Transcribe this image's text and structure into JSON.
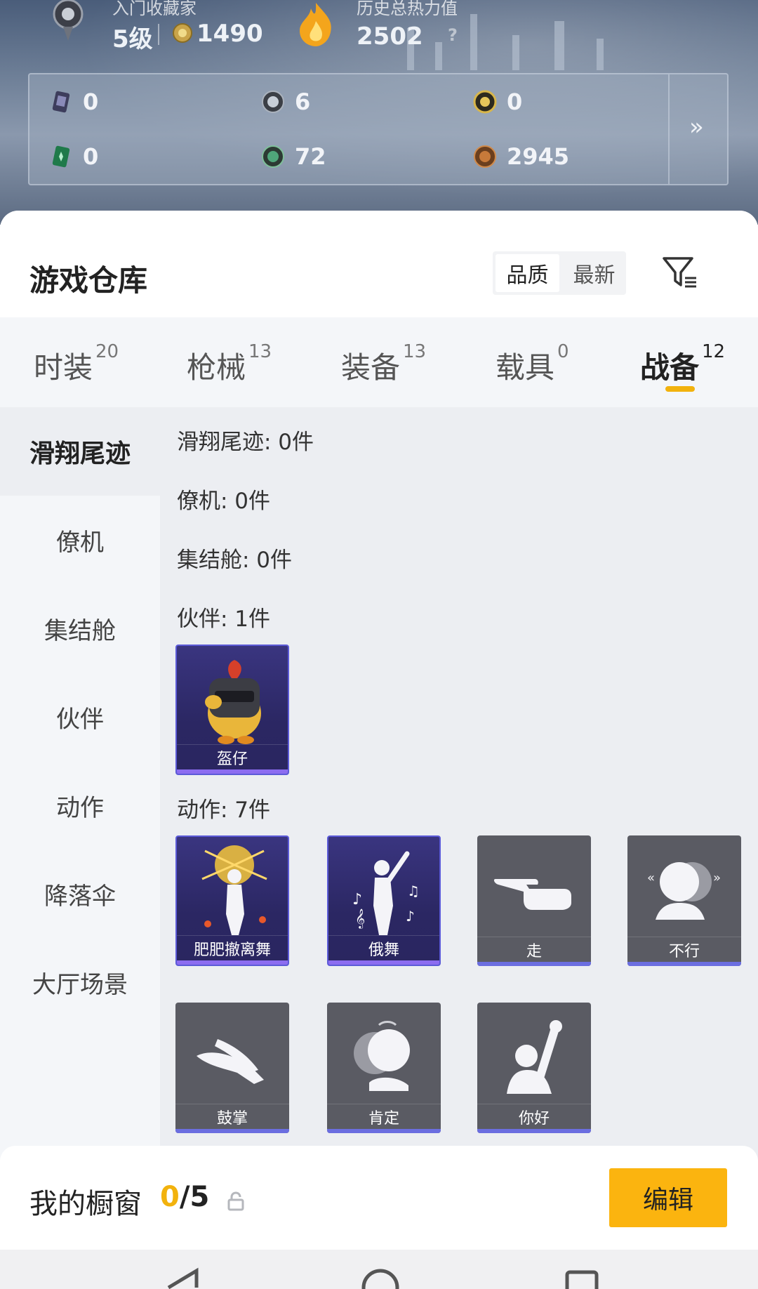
{
  "profile": {
    "rank_name": "入门收藏家",
    "level": "5级",
    "coins": "1490",
    "heat_label": "历史总热力值",
    "heat_value": "2502",
    "heat_help": "?"
  },
  "resources": [
    {
      "icon": "card-icon",
      "value": "0"
    },
    {
      "icon": "silver-coin-icon",
      "value": "6"
    },
    {
      "icon": "gold-token-icon",
      "value": "0"
    },
    {
      "icon": "green-ticket-icon",
      "value": "0"
    },
    {
      "icon": "green-gem-icon",
      "value": "72"
    },
    {
      "icon": "bronze-coin-icon",
      "value": "2945"
    }
  ],
  "resources_more": "»",
  "warehouse": {
    "title": "游戏仓库",
    "sort": {
      "quality": "品质",
      "newest": "最新"
    }
  },
  "tabs": [
    {
      "label": "时装",
      "count": "20"
    },
    {
      "label": "枪械",
      "count": "13"
    },
    {
      "label": "装备",
      "count": "13"
    },
    {
      "label": "载具",
      "count": "0"
    },
    {
      "label": "战备",
      "count": "12"
    }
  ],
  "sidebar": [
    "滑翔尾迹",
    "僚机",
    "集结舱",
    "伙伴",
    "动作",
    "降落伞",
    "大厅场景"
  ],
  "sections": {
    "glide": "滑翔尾迹: 0件",
    "wingman": "僚机: 0件",
    "capsule": "集结舱: 0件",
    "partner": "伙伴: 1件",
    "emote": "动作: 7件"
  },
  "partner_items": [
    {
      "name": "盔仔"
    }
  ],
  "emote_items": [
    {
      "name": "肥肥撤离舞"
    },
    {
      "name": "俄舞"
    },
    {
      "name": "走"
    },
    {
      "name": "不行"
    },
    {
      "name": "鼓掌"
    },
    {
      "name": "肯定"
    },
    {
      "name": "你好"
    }
  ],
  "showcase": {
    "title": "我的橱窗",
    "filled": "0",
    "total": "/5",
    "edit_label": "编辑"
  },
  "colors": {
    "accent": "#fbb40f",
    "purple_frame": "#5c5bd8",
    "gray_card": "#5a5b63"
  }
}
